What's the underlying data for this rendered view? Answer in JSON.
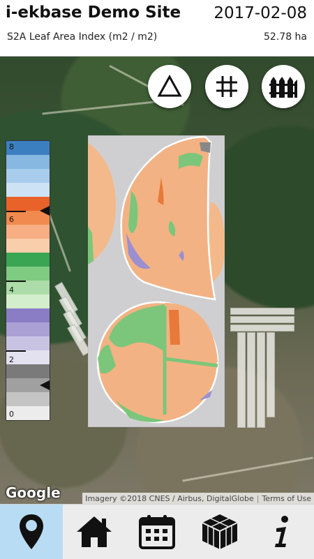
{
  "header": {
    "site_title": "i-ekbase Demo Site",
    "date": "2017-02-08",
    "layer": "S2A Leaf Area Index (m2 / m2)",
    "area": "52.78 ha"
  },
  "map_buttons": [
    {
      "name": "triangle-icon"
    },
    {
      "name": "grid-icon"
    },
    {
      "name": "fence-icon"
    }
  ],
  "legend": {
    "labels": [
      "8",
      "6",
      "4",
      "2",
      "0"
    ],
    "colors": [
      "#3b82c4",
      "#9cc7e8",
      "#e8703a",
      "#f6c9a4",
      "#4fae5e",
      "#b8e2b4",
      "#8c7ec4",
      "#d7d2ea",
      "#7d7d7d",
      "#eeeeee"
    ],
    "current_value_markers": [
      6.3,
      1.2
    ]
  },
  "map": {
    "google_logo": "Google",
    "imagery": "Imagery ©2018 CNES / Airbus, DigitalGlobe",
    "terms": "Terms of Use"
  },
  "tabs": [
    {
      "name": "map-pin-icon",
      "active": true
    },
    {
      "name": "home-icon",
      "active": false
    },
    {
      "name": "calendar-icon",
      "active": false
    },
    {
      "name": "box-icon",
      "active": false
    },
    {
      "name": "info-icon",
      "active": false
    }
  ]
}
